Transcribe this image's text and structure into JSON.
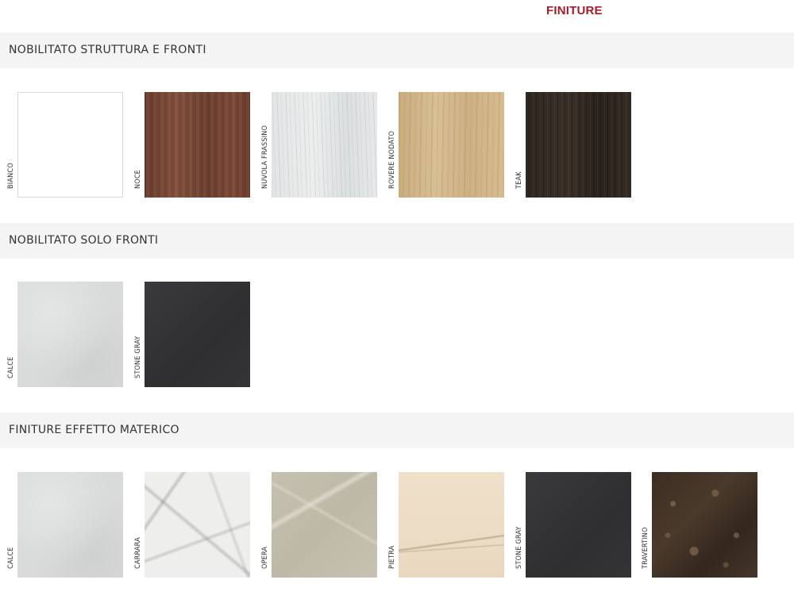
{
  "header": {
    "title": "FINITURE"
  },
  "sections": [
    {
      "title": "NOBILITATO STRUTTURA E FRONTI",
      "swatches": [
        {
          "label": "BIANCO",
          "texture": "bianco",
          "color": "#ffffff"
        },
        {
          "label": "NOCE",
          "texture": "noce",
          "color": "#7a4836"
        },
        {
          "label": "NUVOLA FRASSINO",
          "texture": "frassino",
          "color": "#e3e5e6"
        },
        {
          "label": "ROVERE NODATO",
          "texture": "rovere",
          "color": "#d0b487"
        },
        {
          "label": "TEAK",
          "texture": "teak",
          "color": "#332a23"
        }
      ]
    },
    {
      "title": "NOBILITATO SOLO FRONTI",
      "swatches": [
        {
          "label": "CALCE",
          "texture": "calce",
          "color": "#d9dada"
        },
        {
          "label": "STONE GRAY",
          "texture": "stonegray",
          "color": "#343436"
        }
      ]
    },
    {
      "title": "FINITURE EFFETTO MATERICO",
      "swatches": [
        {
          "label": "CALCE",
          "texture": "calce",
          "color": "#d9dada"
        },
        {
          "label": "CARRARA",
          "texture": "carrara",
          "color": "#eeeeec"
        },
        {
          "label": "OPERA",
          "texture": "opera",
          "color": "#c3bdad"
        },
        {
          "label": "PIETRA",
          "texture": "pietra",
          "color": "#ecdcc5"
        },
        {
          "label": "STONE GRAY",
          "texture": "stonegray",
          "color": "#343436"
        },
        {
          "label": "TRAVERTINO",
          "texture": "travertino",
          "color": "#3f3025"
        }
      ]
    }
  ],
  "colors": {
    "accent": "#a51c2a",
    "section_bg": "#f4f4f4"
  }
}
